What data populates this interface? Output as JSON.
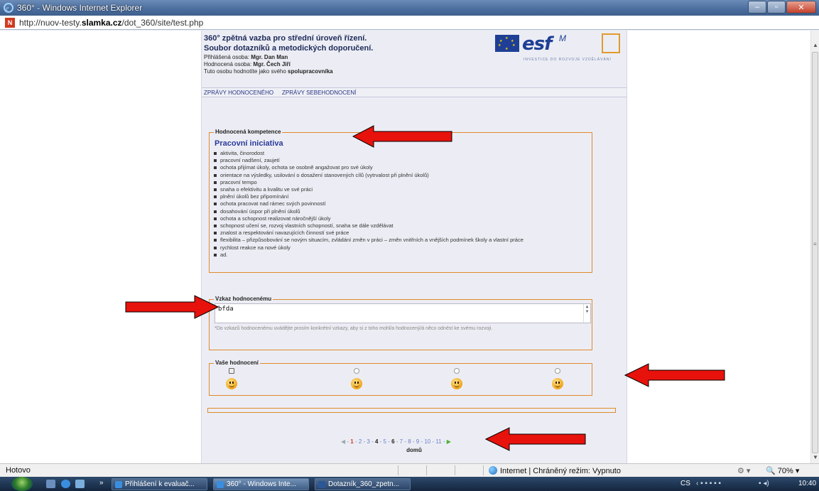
{
  "window": {
    "title": "360° - Windows Internet Explorer",
    "url_prefix": "http://nuov-testy.",
    "url_domain": "slamka.cz",
    "url_path": "/dot_360/site/test.php"
  },
  "header": {
    "title_line1": "360° zpětná vazba pro střední úroveň řízení.",
    "title_line2": "Soubor dotazníků a metodických doporučení.",
    "logged_label": "Přihlášená osoba: ",
    "logged_name": "Mgr. Dan Man",
    "rated_label": "Hodnocená osoba: ",
    "rated_name": "Mgr. Čech Jiří",
    "role_prefix": "Tuto osobu hodnotíte jako svého ",
    "role_name": "spolupracovníka",
    "logo_esf": "esf",
    "logo_tagline": "INVESTICE DO ROZVOJE VZDĚLÁVÁNÍ"
  },
  "tabs": [
    "ZPRÁVY HODNOCENÉHO",
    "ZPRÁVY SEBEHODNOCENÍ"
  ],
  "competence": {
    "legend": "Hodnocená kompetence",
    "title": "Pracovní iniciativa",
    "items": [
      "aktivita, činorodost",
      "pracovní nadšení, zaujetí",
      "ochota přijímat úkoly, ochota se osobně angažovat pro své úkoly",
      "orientace na výsledky, usilování o dosažení stanovených cílů (vytrvalost při plnění úkolů)",
      "pracovní tempo",
      "snaha o efektivitu a kvalitu ve své práci",
      "plnění úkolů bez připomínání",
      "ochota pracovat nad rámec svých povinností",
      "dosahování úspor při plnění úkolů",
      "ochota a schopnost realizovat náročnější úkoly",
      "schopnost učení se, rozvoj vlastních schopností, snaha se dále vzdělávat",
      "znalost a respektování navazujících činností své práce",
      "flexibilita – přizpůsobování se novým situacím, zvládání změn v práci – změn vnitřních a vnějších podmínek školy a vlastní práce",
      "rychlost reakce na nové úkoly",
      "ad."
    ]
  },
  "message": {
    "legend": "Vzkaz hodnocenému",
    "value": "bfda",
    "note": "*Do vzkazů hodnocenému uvádějte prosím konkrétní vzkazy, aby si z toho mohl/a hodnocený/á něco odnést ke svému rozvoji."
  },
  "rating": {
    "legend": "Vaše hodnocení",
    "selected_index": 0,
    "options_count": 4
  },
  "pager": {
    "pages": [
      "1",
      "2",
      "3",
      "4",
      "5",
      "6",
      "7",
      "8",
      "9",
      "10",
      "11"
    ],
    "current": "1",
    "bold_pages": [
      "4",
      "6"
    ],
    "home": "domů"
  },
  "status": {
    "left": "Hotovo",
    "zone": "Internet | Chráněný režim: Vypnuto",
    "zoom": "70%"
  },
  "taskbar": {
    "tasks": [
      "Přihlášení k evaluač...",
      "360° - Windows Inte...",
      "Dotazník_360_zpetn..."
    ],
    "lang": "CS",
    "clock": "10:40"
  },
  "colors": {
    "accent": "#e08a2a",
    "arrow": "#e8120c",
    "link": "#2a3a9a"
  }
}
